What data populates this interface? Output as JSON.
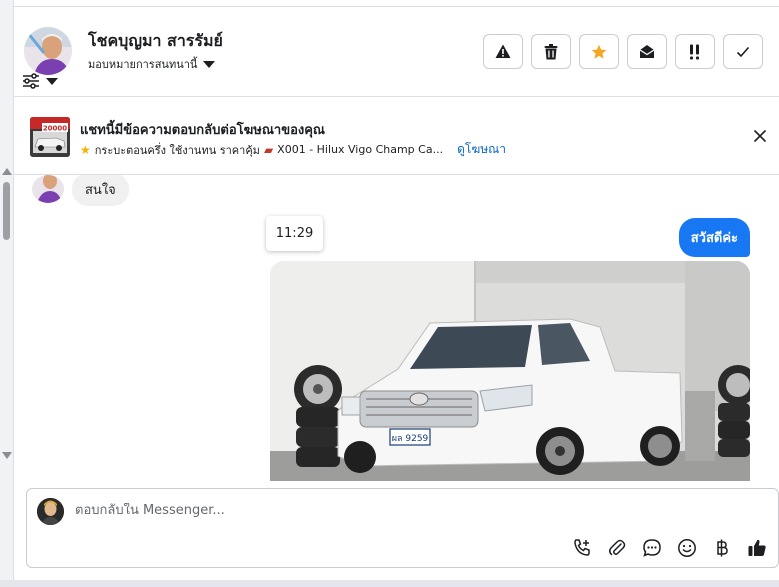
{
  "contact": {
    "name": "โชคบุญมา สารรัมย์",
    "assign_label": "มอบหมายการสนทนานี้"
  },
  "header_actions": [
    {
      "name": "report-spam-button",
      "icon": "warning-icon"
    },
    {
      "name": "delete-button",
      "icon": "trash-icon"
    },
    {
      "name": "star-button",
      "icon": "star-icon"
    },
    {
      "name": "mark-unread-button",
      "icon": "open-envelope-icon"
    },
    {
      "name": "follow-up-button",
      "icon": "exclamation-icon"
    },
    {
      "name": "mark-done-button",
      "icon": "check-icon"
    }
  ],
  "ad_banner": {
    "title": "แชทนี้มีข้อความตอบกลับต่อโฆษณาของคุณ",
    "thumb_price": "20000",
    "description": "กระบะตอนครึ่ง ใช้งานทน ราคาคุ้ม",
    "listing": "X001 - Hilux Vigo Champ Ca...",
    "link": "ดูโฆษณา"
  },
  "messages": {
    "incoming_text": "สนใจ",
    "time": "11:29",
    "outgoing_text": "สวัสดีค่ะ",
    "photo_plate": "ผล 9259"
  },
  "composer": {
    "placeholder": "ตอบกลับใน Messenger..."
  },
  "colors": {
    "accent": "#1877f2",
    "star": "#f5a623",
    "link": "#0a66c2"
  }
}
